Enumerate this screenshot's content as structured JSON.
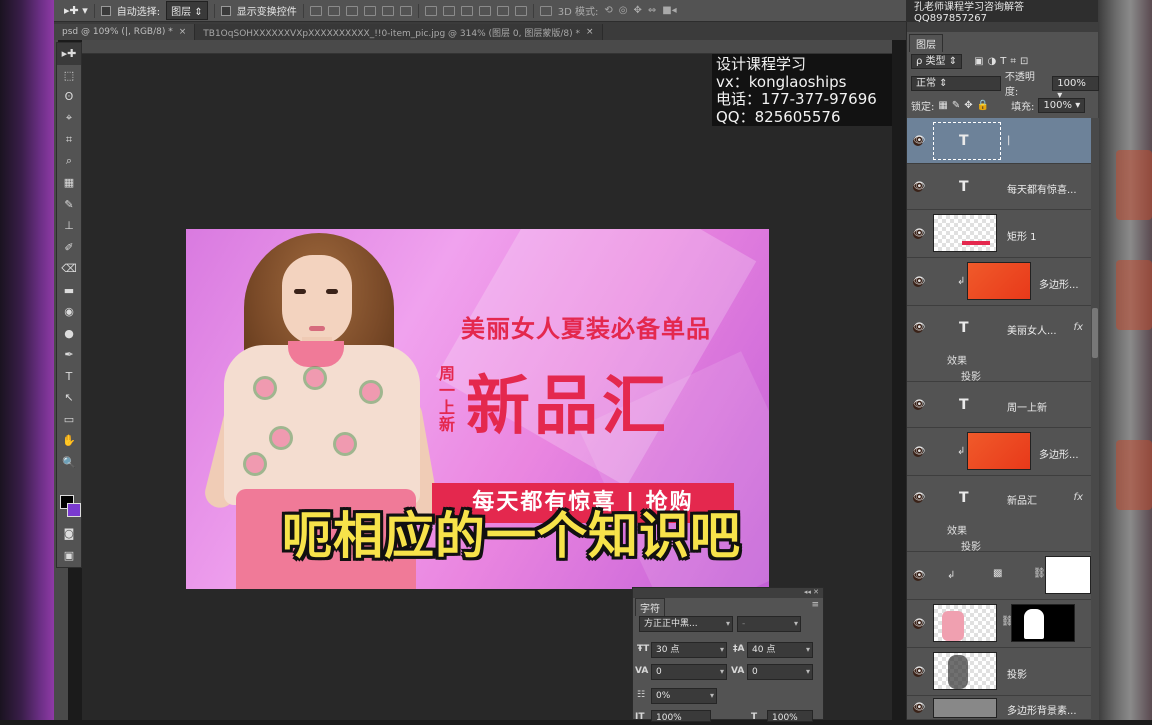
{
  "options_bar": {
    "auto_select_label": "自动选择:",
    "auto_select_value": "图层",
    "show_transform_label": "显示变换控件",
    "mode_3d_label": "3D 模式:"
  },
  "watermark_top": "孔老师课程学习咨询解答 QQ897857267",
  "doc_tabs": [
    {
      "label": "psd @ 109% (|, RGB/8) *",
      "close": "×"
    },
    {
      "label": "TB1OqSOHXXXXXXVXpXXXXXXXXXX_!!0-item_pic.jpg @ 314% (图层 0, 图层蒙版/8) *",
      "close": "×"
    }
  ],
  "toolbar": {
    "tools": [
      "▸✚",
      "⬚",
      "ʘ",
      "⌖",
      "⌗",
      "⌕",
      "▦",
      "✎",
      "⊥",
      "✐",
      "⌫",
      "▬",
      "◉",
      "●",
      "✒",
      "T",
      "↖",
      "▭",
      "✋",
      "🔍"
    ]
  },
  "contact_overlay": {
    "line1": "设计课程学习",
    "line2": "vx：konglaoships",
    "line3": "电话：177-377-97696",
    "line4": "QQ：825605576"
  },
  "banner": {
    "subtitle": "美丽女人夏装必备单品",
    "tag": "周一上新",
    "title": "新品汇",
    "bottom_bar": "每天都有惊喜 | 抢购"
  },
  "video_subtitle": "呃相应的一个知识吧",
  "character_panel": {
    "tab": "字符",
    "font_family": "方正正中黑...",
    "font_style": "-",
    "font_size": "30 点",
    "leading": "40 点",
    "kerning": "0",
    "tracking": "0",
    "scale_percent": "0%",
    "vert_scale": "100%",
    "horiz_scale": "100%"
  },
  "layers_panel": {
    "tab": "图层",
    "filter_label": "ρ 类型",
    "blend_mode": "正常",
    "opacity_label": "不透明度:",
    "opacity_value": "100%",
    "lock_label": "锁定:",
    "fill_label": "填充:",
    "fill_value": "100%",
    "layers": [
      {
        "name": "|",
        "kind": "text",
        "selected": true
      },
      {
        "name": "每天都有惊喜...",
        "kind": "text"
      },
      {
        "name": "矩形 1",
        "kind": "shape"
      },
      {
        "name": "多边形...",
        "kind": "image"
      },
      {
        "name": "美丽女人...",
        "kind": "text",
        "fx": "fx",
        "effects": "效果",
        "effect1": "投影"
      },
      {
        "name": "周一上新",
        "kind": "text"
      },
      {
        "name": "多边形...",
        "kind": "image"
      },
      {
        "name": "新品汇",
        "kind": "text",
        "fx": "fx",
        "effects": "效果",
        "effect1": "投影"
      },
      {
        "name": "",
        "kind": "adjust"
      },
      {
        "name": "",
        "kind": "masked-photo"
      },
      {
        "name": "投影",
        "kind": "image"
      },
      {
        "name": "多边形背景素...",
        "kind": "image"
      }
    ]
  },
  "colors": {
    "accent_red": "#e4284e",
    "selected_layer": "#6d8299",
    "subtitle_yellow": "#f7e34a"
  }
}
